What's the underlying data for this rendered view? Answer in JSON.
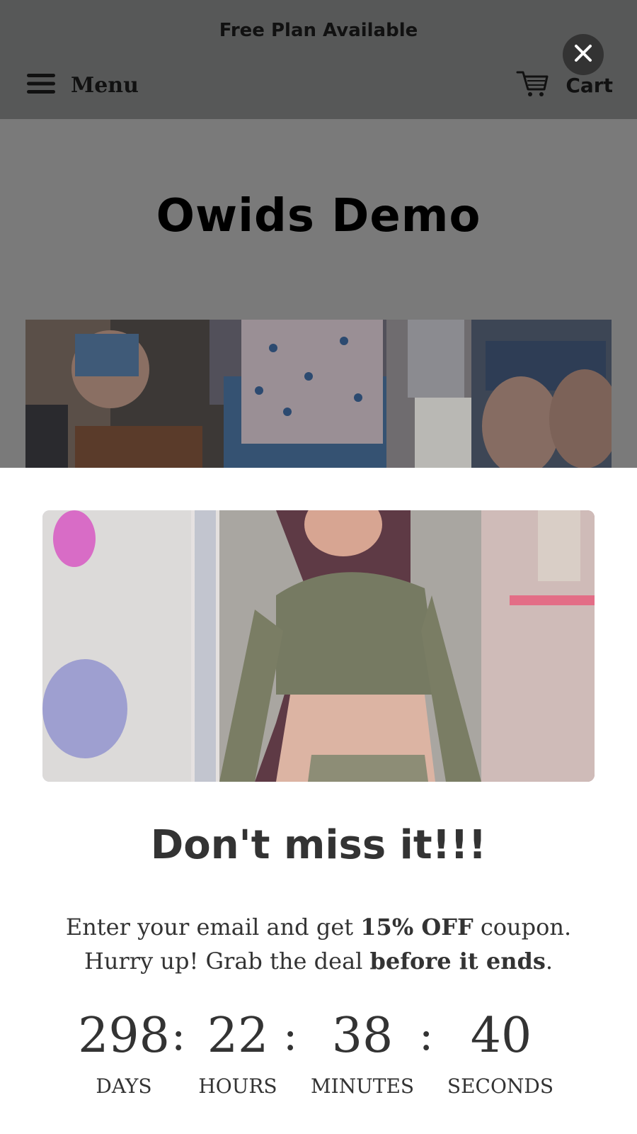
{
  "header": {
    "announcement": "Free Plan Available",
    "menu_label": "Menu",
    "cart_label": "Cart"
  },
  "store": {
    "title": "Owids Demo"
  },
  "popup": {
    "title": "Don't miss it!!!",
    "desc_line1_a": "Enter your email and get ",
    "desc_line1_b": "15% OFF",
    "desc_line1_c": " coupon.",
    "desc_line2_a": "Hurry up! Grab the deal ",
    "desc_line2_b": "before it ends",
    "desc_line2_c": ".",
    "countdown": {
      "days": "298",
      "hours": "22",
      "minutes": "38",
      "seconds": "40",
      "days_label": "DAYS",
      "hours_label": "HOURS",
      "minutes_label": "MINUTES",
      "seconds_label": "SECONDS",
      "separator": ":"
    }
  },
  "icons": {
    "menu": "hamburger-icon",
    "cart": "cart-icon",
    "close": "close-icon"
  },
  "colors": {
    "header_bg": "#575858",
    "overlay_bg": "#7a7a7a",
    "text_dark": "#333333",
    "close_bg": "#333333"
  }
}
